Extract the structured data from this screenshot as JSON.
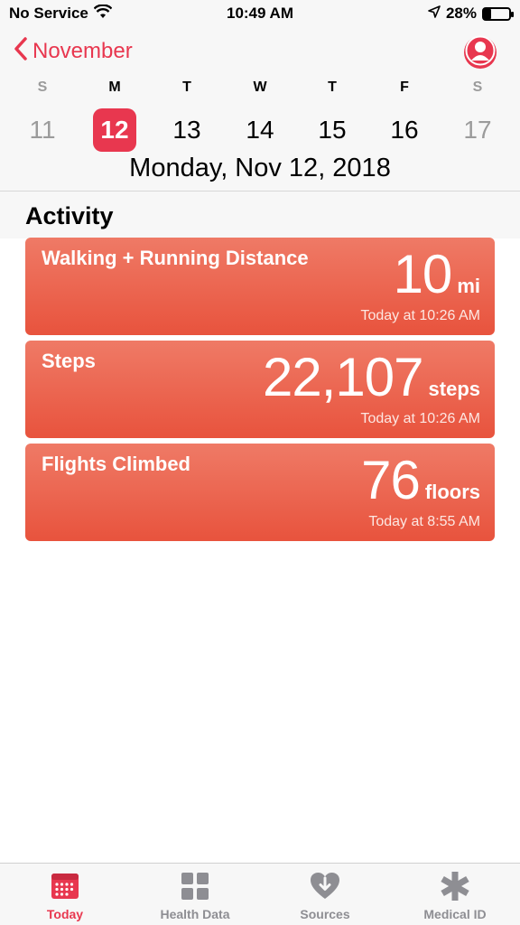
{
  "status_bar": {
    "carrier": "No Service",
    "time": "10:49 AM",
    "battery": "28%",
    "battery_level": 0.28
  },
  "header": {
    "back_label": "November",
    "weekdays": [
      "S",
      "M",
      "T",
      "W",
      "T",
      "F",
      "S"
    ],
    "days": [
      "11",
      "12",
      "13",
      "14",
      "15",
      "16",
      "17"
    ],
    "selected_day_index": 1,
    "date_title": "Monday, Nov 12, 2018"
  },
  "section": {
    "title": "Activity"
  },
  "cards": [
    {
      "title": "Walking + Running Distance",
      "value": "10",
      "unit": "mi",
      "time": "Today at 10:26 AM"
    },
    {
      "title": "Steps",
      "value": "22,107",
      "unit": "steps",
      "time": "Today at 10:26 AM"
    },
    {
      "title": "Flights Climbed",
      "value": "76",
      "unit": "floors",
      "time": "Today at 8:55 AM"
    }
  ],
  "tabs": [
    {
      "label": "Today",
      "icon": "calendar-icon",
      "active": true
    },
    {
      "label": "Health Data",
      "icon": "grid-icon",
      "active": false
    },
    {
      "label": "Sources",
      "icon": "heart-download-icon",
      "active": false
    },
    {
      "label": "Medical ID",
      "icon": "asterisk-icon",
      "active": false
    }
  ],
  "colors": {
    "accent": "#e8374f",
    "card_top": "#ef7a66",
    "card_bottom": "#e8533d",
    "inactive": "#8e8e93"
  }
}
